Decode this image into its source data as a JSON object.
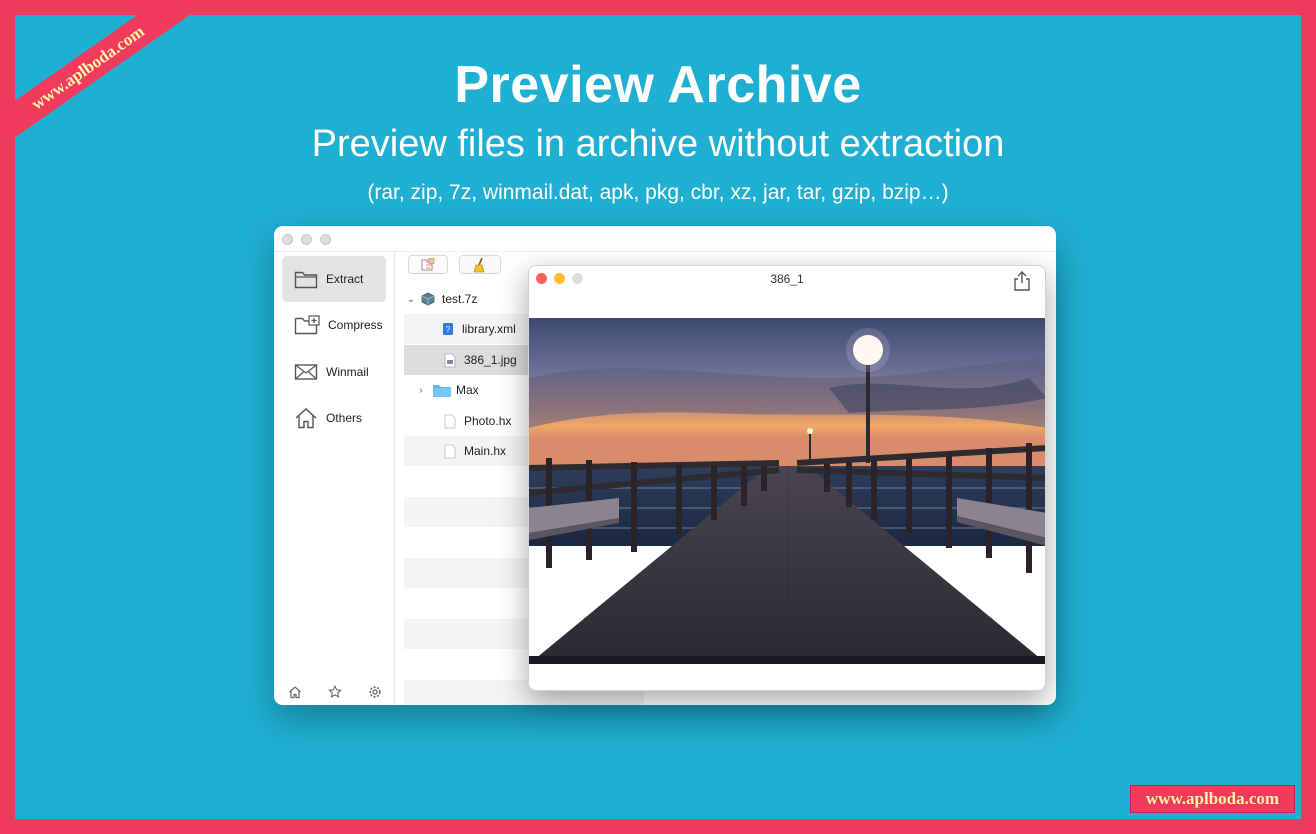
{
  "headline": "Preview Archive",
  "subhead": "Preview files in archive without extraction",
  "formats": "(rar, zip, 7z, winmail.dat, apk, pkg, cbr, xz, jar, tar, gzip, bzip…)",
  "watermark": {
    "ribbon": "www.aplboda.com",
    "box": "www.aplboda.com"
  },
  "sidebar": {
    "items": [
      {
        "label": "Extract",
        "icon": "folder-icon"
      },
      {
        "label": "Compress",
        "icon": "folder-plus-icon"
      },
      {
        "label": "Winmail",
        "icon": "envelope-icon"
      },
      {
        "label": "Others",
        "icon": "house-icon"
      }
    ],
    "footer": [
      "home-icon",
      "star-icon",
      "gear-icon"
    ]
  },
  "toolbar": {
    "buttons": [
      "extract-icon",
      "clean-icon"
    ]
  },
  "tree": {
    "root": "test.7z",
    "items": [
      {
        "name": "library.xml",
        "icon": "xml-file-icon"
      },
      {
        "name": "386_1.jpg",
        "icon": "image-file-icon"
      },
      {
        "name": "Max",
        "icon": "folder-icon"
      },
      {
        "name": "Photo.hx",
        "icon": "file-icon"
      },
      {
        "name": "Main.hx",
        "icon": "file-icon"
      }
    ]
  },
  "preview": {
    "title": "386_1"
  },
  "colors": {
    "background": "#1fafd2",
    "border": "#f23a5c",
    "watermark_text": "#fff5a8"
  }
}
